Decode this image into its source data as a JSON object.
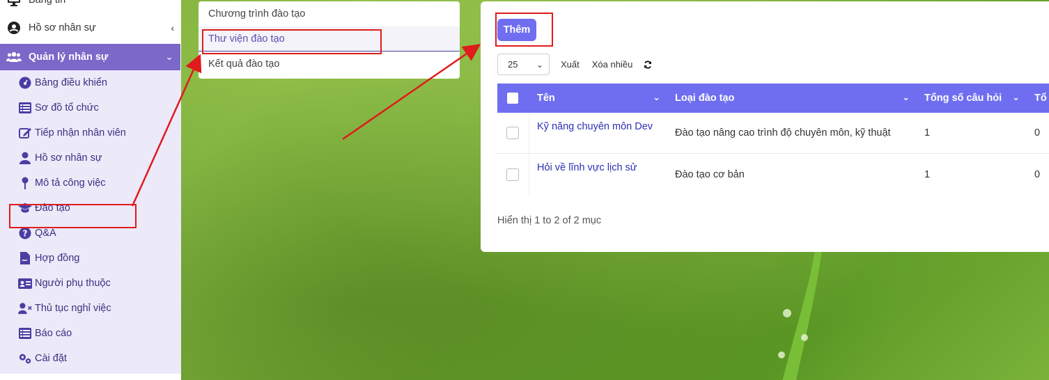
{
  "sidebar": {
    "top_items": [
      {
        "label": "Bảng tin",
        "icon": "monitor-icon"
      },
      {
        "label": "Hồ sơ nhân sự",
        "icon": "user-circle-icon"
      }
    ],
    "active_section": {
      "label": "Quản lý nhân sự",
      "icon": "users-icon"
    },
    "sub_items": [
      {
        "label": "Bảng điều khiển",
        "icon": "dashboard-icon"
      },
      {
        "label": "Sơ đồ tổ chức",
        "icon": "list-table-icon"
      },
      {
        "label": "Tiếp nhận nhân viên",
        "icon": "edit-icon"
      },
      {
        "label": "Hồ sơ nhân sự",
        "icon": "user-icon"
      },
      {
        "label": "Mô tả công việc",
        "icon": "map-pin-icon"
      },
      {
        "label": "Đào tạo",
        "icon": "graduation-cap-icon"
      },
      {
        "label": "Q&A",
        "icon": "question-icon"
      },
      {
        "label": "Hợp đồng",
        "icon": "file-contract-icon"
      },
      {
        "label": "Người phụ thuộc",
        "icon": "id-card-icon"
      },
      {
        "label": "Thủ tục nghỉ việc",
        "icon": "user-remove-icon"
      },
      {
        "label": "Báo cáo",
        "icon": "report-list-icon"
      },
      {
        "label": "Cài đặt",
        "icon": "gears-icon"
      }
    ]
  },
  "training_menu": {
    "items": [
      "Chương trình đào tạo",
      "Thư viện đào tạo",
      "Kết quả đào tạo"
    ],
    "selected": "Thư viện đào tạo"
  },
  "toolbar": {
    "add_label": "Thêm",
    "page_size": "25",
    "export_label": "Xuất",
    "delete_many_label": "Xóa nhiều"
  },
  "table": {
    "headers": [
      "Tên",
      "Loại đào tạo",
      "Tổng số câu hỏi",
      "Tổ"
    ],
    "rows": [
      {
        "name": "Kỹ năng chuyên môn Dev",
        "type": "Đào tạo nâng cao trình độ chuyên môn, kỹ thuật",
        "total": "1",
        "extra": "0"
      },
      {
        "name": "Hỏi về lĩnh vực lịch sử",
        "type": "Đào tạo cơ bản",
        "total": "1",
        "extra": "0"
      }
    ],
    "info": "Hiển thị 1 to 2 of 2 mục"
  },
  "colors": {
    "sidebar_active": "#7b68c8",
    "submenu_bg": "#ece9f9",
    "primary": "#6f6ef0",
    "annotation_red": "#e01b1b"
  }
}
